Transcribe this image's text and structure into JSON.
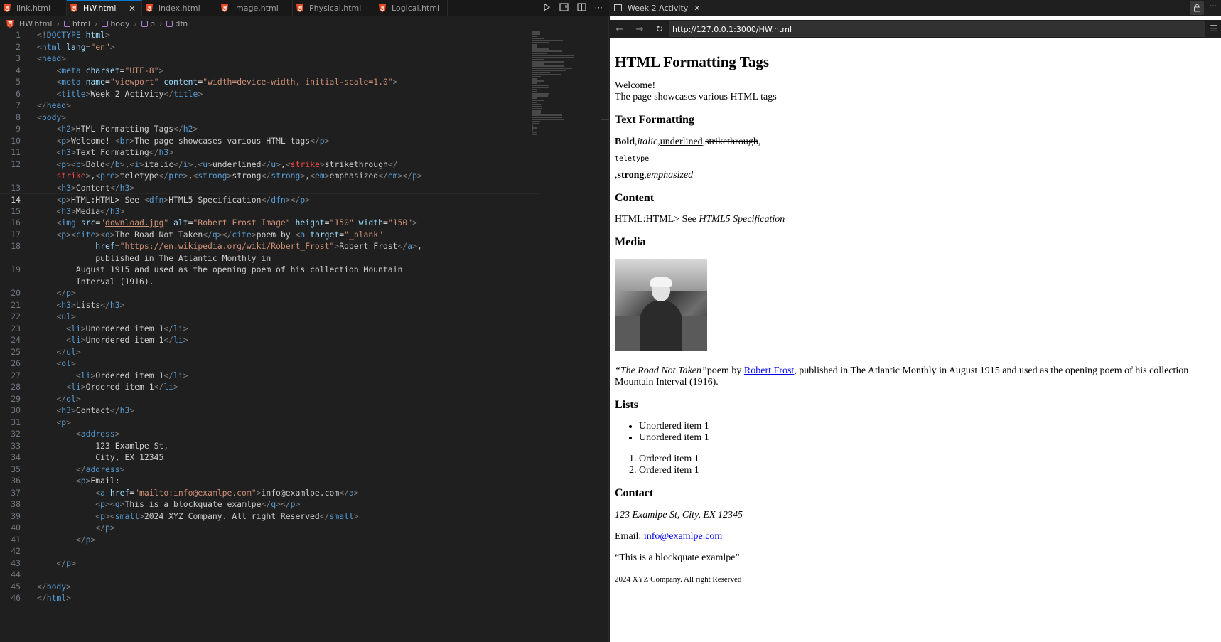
{
  "editor": {
    "tabs": [
      {
        "label": "link.html",
        "active": false
      },
      {
        "label": "HW.html",
        "active": true
      },
      {
        "label": "index.html",
        "active": false
      },
      {
        "label": "image.html",
        "active": false
      },
      {
        "label": "Physical.html",
        "active": false
      },
      {
        "label": "Logical.html",
        "active": false
      }
    ],
    "breadcrumb": [
      "HW.html",
      "html",
      "body",
      "p",
      "dfn"
    ],
    "current_line": 14,
    "lines": [
      {
        "n": "1",
        "html": "<span class='br'>&lt;!</span><span class='tg'>DOCTYPE</span> <span class='at'>html</span><span class='br'>&gt;</span>"
      },
      {
        "n": "2",
        "html": "<span class='br'>&lt;</span><span class='tg'>html</span> <span class='at'>lang</span>=<span class='st'>\"en\"</span><span class='br'>&gt;</span>"
      },
      {
        "n": "3",
        "html": "<span class='br'>&lt;</span><span class='tg'>head</span><span class='br'>&gt;</span>"
      },
      {
        "n": "4",
        "html": "    <span class='br'>&lt;</span><span class='tg'>meta</span> <span class='at'>charset</span>=<span class='st'>\"UTF-8\"</span><span class='br'>&gt;</span>"
      },
      {
        "n": "5",
        "html": "    <span class='br'>&lt;</span><span class='tg'>meta</span> <span class='at'>name</span>=<span class='st'>\"viewport\"</span> <span class='at'>content</span>=<span class='st'>\"width=device-width, initial-scale=1.0\"</span><span class='br'>&gt;</span>"
      },
      {
        "n": "6",
        "html": "    <span class='br'>&lt;</span><span class='tg'>title</span><span class='br'>&gt;</span>Week 2 Activity<span class='br'>&lt;/</span><span class='tg'>title</span><span class='br'>&gt;</span>"
      },
      {
        "n": "7",
        "html": "<span class='br'>&lt;/</span><span class='tg'>head</span><span class='br'>&gt;</span>"
      },
      {
        "n": "8",
        "html": "<span class='br'>&lt;</span><span class='tg'>body</span><span class='br'>&gt;</span>"
      },
      {
        "n": "9",
        "html": "    <span class='br'>&lt;</span><span class='tg'>h2</span><span class='br'>&gt;</span>HTML Formatting Tags<span class='br'>&lt;/</span><span class='tg'>h2</span><span class='br'>&gt;</span>"
      },
      {
        "n": "10",
        "html": "    <span class='br'>&lt;</span><span class='tg'>p</span><span class='br'>&gt;</span>Welcome! <span class='br'>&lt;</span><span class='tg'>br</span><span class='br'>&gt;</span>The page showcases various HTML tags<span class='br'>&lt;/</span><span class='tg'>p</span><span class='br'>&gt;</span>"
      },
      {
        "n": "11",
        "html": "    <span class='br'>&lt;</span><span class='tg'>h3</span><span class='br'>&gt;</span>Text Formatting<span class='br'>&lt;/</span><span class='tg'>h3</span><span class='br'>&gt;</span>"
      },
      {
        "n": "12",
        "html": "    <span class='br'>&lt;</span><span class='tg'>p</span><span class='br'>&gt;&lt;</span><span class='tg'>b</span><span class='br'>&gt;</span>Bold<span class='br'>&lt;/</span><span class='tg'>b</span><span class='br'>&gt;</span>,<span class='br'>&lt;</span><span class='tg'>i</span><span class='br'>&gt;</span>italic<span class='br'>&lt;/</span><span class='tg'>i</span><span class='br'>&gt;</span>,<span class='br'>&lt;</span><span class='tg'>u</span><span class='br'>&gt;</span>underlined<span class='br'>&lt;/</span><span class='tg'>u</span><span class='br'>&gt;</span>,<span class='br'>&lt;</span><span class='dtg'>strike</span><span class='br'>&gt;</span>strikethrough<span class='br'>&lt;/</span>"
      },
      {
        "n": "",
        "html": "    <span class='dtg'>strike</span><span class='br'>&gt;</span>,<span class='br'>&lt;</span><span class='tg'>pre</span><span class='br'>&gt;</span>teletype<span class='br'>&lt;/</span><span class='tg'>pre</span><span class='br'>&gt;</span>,<span class='br'>&lt;</span><span class='tg'>strong</span><span class='br'>&gt;</span>strong<span class='br'>&lt;/</span><span class='tg'>strong</span><span class='br'>&gt;</span>,<span class='br'>&lt;</span><span class='tg'>em</span><span class='br'>&gt;</span>emphasized<span class='br'>&lt;/</span><span class='tg'>em</span><span class='br'>&gt;&lt;/</span><span class='tg'>p</span><span class='br'>&gt;</span>"
      },
      {
        "n": "13",
        "html": "    <span class='br'>&lt;</span><span class='tg'>h3</span><span class='br'>&gt;</span>Content<span class='br'>&lt;/</span><span class='tg'>h3</span><span class='br'>&gt;</span>"
      },
      {
        "n": "14",
        "html": "    <span class='br'>&lt;</span><span class='tg'>p</span><span class='br'>&gt;</span>HTML:HTML&gt; See <span class='br'>&lt;</span><span class='tg'>dfn</span><span class='br'>&gt;</span>HTML5 Specification<span class='br'>&lt;/</span><span class='tg'>dfn</span><span class='br'>&gt;&lt;/</span><span class='tg'>p</span><span class='br'>&gt;</span>"
      },
      {
        "n": "15",
        "html": "    <span class='br'>&lt;</span><span class='tg'>h3</span><span class='br'>&gt;</span>Media<span class='br'>&lt;/</span><span class='tg'>h3</span><span class='br'>&gt;</span>"
      },
      {
        "n": "16",
        "html": "    <span class='br'>&lt;</span><span class='tg'>img</span> <span class='at'>src</span>=<span class='st'>\"<span class='ul'>download.jpg</span>\"</span> <span class='at'>alt</span>=<span class='st'>\"Robert Frost Image\"</span> <span class='at'>height</span>=<span class='st'>\"150\"</span> <span class='at'>width</span>=<span class='st'>\"150\"</span><span class='br'>&gt;</span>"
      },
      {
        "n": "17",
        "html": "    <span class='br'>&lt;</span><span class='tg'>p</span><span class='br'>&gt;&lt;</span><span class='tg'>cite</span><span class='br'>&gt;&lt;</span><span class='tg'>q</span><span class='br'>&gt;</span>The Road Not Taken<span class='br'>&lt;/</span><span class='tg'>q</span><span class='br'>&gt;&lt;/</span><span class='tg'>cite</span><span class='br'>&gt;</span>poem by <span class='br'>&lt;</span><span class='tg'>a</span> <span class='at'>target</span>=<span class='st'>\"_blank\"</span>"
      },
      {
        "n": "18",
        "html": "            <span class='at'>href</span>=<span class='st'>\"<span class='ul'>https://en.wikipedia.org/wiki/Robert_Frost</span>\"</span><span class='br'>&gt;</span>Robert Frost<span class='br'>&lt;/</span><span class='tg'>a</span><span class='br'>&gt;</span>,"
      },
      {
        "n": "",
        "html": "            published in The Atlantic Monthly in"
      },
      {
        "n": "19",
        "html": "        August 1915 and used as the opening poem of his collection Mountain"
      },
      {
        "n": "",
        "html": "        Interval (1916)."
      },
      {
        "n": "20",
        "html": "    <span class='br'>&lt;/</span><span class='tg'>p</span><span class='br'>&gt;</span>"
      },
      {
        "n": "21",
        "html": "    <span class='br'>&lt;</span><span class='tg'>h3</span><span class='br'>&gt;</span>Lists<span class='br'>&lt;/</span><span class='tg'>h3</span><span class='br'>&gt;</span>"
      },
      {
        "n": "22",
        "html": "    <span class='br'>&lt;</span><span class='tg'>ul</span><span class='br'>&gt;</span>"
      },
      {
        "n": "23",
        "html": "      <span class='br'>&lt;</span><span class='tg'>li</span><span class='br'>&gt;</span>Unordered item 1<span class='br'>&lt;/</span><span class='tg'>li</span><span class='br'>&gt;</span>"
      },
      {
        "n": "24",
        "html": "      <span class='br'>&lt;</span><span class='tg'>li</span><span class='br'>&gt;</span>Unordered item 1<span class='br'>&lt;/</span><span class='tg'>li</span><span class='br'>&gt;</span>"
      },
      {
        "n": "25",
        "html": "    <span class='br'>&lt;/</span><span class='tg'>ul</span><span class='br'>&gt;</span>"
      },
      {
        "n": "26",
        "html": "    <span class='br'>&lt;</span><span class='tg'>ol</span><span class='br'>&gt;</span>"
      },
      {
        "n": "27",
        "html": "        <span class='br'>&lt;</span><span class='tg'>li</span><span class='br'>&gt;</span>Ordered item 1<span class='br'>&lt;/</span><span class='tg'>li</span><span class='br'>&gt;</span>"
      },
      {
        "n": "28",
        "html": "      <span class='br'>&lt;</span><span class='tg'>li</span><span class='br'>&gt;</span>Ordered item 1<span class='br'>&lt;/</span><span class='tg'>li</span><span class='br'>&gt;</span>"
      },
      {
        "n": "29",
        "html": "    <span class='br'>&lt;/</span><span class='tg'>ol</span><span class='br'>&gt;</span>"
      },
      {
        "n": "30",
        "html": "    <span class='br'>&lt;</span><span class='tg'>h3</span><span class='br'>&gt;</span>Contact<span class='br'>&lt;/</span><span class='tg'>h3</span><span class='br'>&gt;</span>"
      },
      {
        "n": "31",
        "html": "    <span class='br'>&lt;</span><span class='tg'>p</span><span class='br'>&gt;</span>"
      },
      {
        "n": "32",
        "html": "        <span class='br'>&lt;</span><span class='tg'>address</span><span class='br'>&gt;</span>"
      },
      {
        "n": "33",
        "html": "            123 Examlpe St,"
      },
      {
        "n": "34",
        "html": "            City, EX 12345"
      },
      {
        "n": "35",
        "html": "        <span class='br'>&lt;/</span><span class='tg'>address</span><span class='br'>&gt;</span>"
      },
      {
        "n": "36",
        "html": "        <span class='br'>&lt;</span><span class='tg'>p</span><span class='br'>&gt;</span>Email:"
      },
      {
        "n": "37",
        "html": "            <span class='br'>&lt;</span><span class='tg'>a</span> <span class='at'>href</span>=<span class='st'>\"mailto:info@examlpe.com\"</span><span class='br'>&gt;</span>info@examlpe.com<span class='br'>&lt;/</span><span class='tg'>a</span><span class='br'>&gt;</span>"
      },
      {
        "n": "38",
        "html": "            <span class='br'>&lt;</span><span class='tg'>p</span><span class='br'>&gt;&lt;</span><span class='tg'>q</span><span class='br'>&gt;</span>This is a blockquate examlpe<span class='br'>&lt;/</span><span class='tg'>q</span><span class='br'>&gt;&lt;/</span><span class='tg'>p</span><span class='br'>&gt;</span>"
      },
      {
        "n": "39",
        "html": "            <span class='br'>&lt;</span><span class='tg'>p</span><span class='br'>&gt;&lt;</span><span class='tg'>small</span><span class='br'>&gt;</span>2024 XYZ Company. All right Reserved<span class='br'>&lt;/</span><span class='tg'>small</span><span class='br'>&gt;</span>"
      },
      {
        "n": "40",
        "html": "            <span class='br'>&lt;/</span><span class='tg'>p</span><span class='br'>&gt;</span>"
      },
      {
        "n": "41",
        "html": "        <span class='br'>&lt;/</span><span class='tg'>p</span><span class='br'>&gt;</span>"
      },
      {
        "n": "42",
        "html": ""
      },
      {
        "n": "43",
        "html": "    <span class='br'>&lt;/</span><span class='tg'>p</span><span class='br'>&gt;</span>"
      },
      {
        "n": "44",
        "html": ""
      },
      {
        "n": "45",
        "html": "<span class='br'>&lt;/</span><span class='tg'>body</span><span class='br'>&gt;</span>"
      },
      {
        "n": "46",
        "html": "<span class='br'>&lt;/</span><span class='tg'>html</span><span class='br'>&gt;</span>"
      }
    ]
  },
  "browser": {
    "tab_title": "Week 2 Activity",
    "url": "http://127.0.0.1:3000/HW.html",
    "page": {
      "h2": "HTML Formatting Tags",
      "welcome": "Welcome!",
      "showcase": "The page showcases various HTML tags",
      "text_formatting_heading": "Text Formatting",
      "bold": "Bold",
      "italic": "italic",
      "underlined": "underlined",
      "strike": "strikethrough",
      "teletype": "teletype",
      "strong": "strong",
      "emphasized": "emphasized",
      "content_heading": "Content",
      "content_prefix": "HTML:HTML> See ",
      "dfn": "HTML5 Specification",
      "media_heading": "Media",
      "poem_title": "“The Road Not Taken”",
      "poem_by": "poem by ",
      "poem_author": "Robert Frost",
      "poem_rest": ", published in The Atlantic Monthly in August 1915 and used as the opening poem of his collection Mountain Interval (1916).",
      "lists_heading": "Lists",
      "unordered": [
        "Unordered item 1",
        "Unordered item 1"
      ],
      "ordered": [
        "Ordered item 1",
        "Ordered item 1"
      ],
      "contact_heading": "Contact",
      "address": "123 Examlpe St, City, EX 12345",
      "email_label": "Email: ",
      "email": "info@examlpe.com",
      "quote": "“This is a blockquate examlpe”",
      "copyright": "2024 XYZ Company. All right Reserved"
    }
  }
}
